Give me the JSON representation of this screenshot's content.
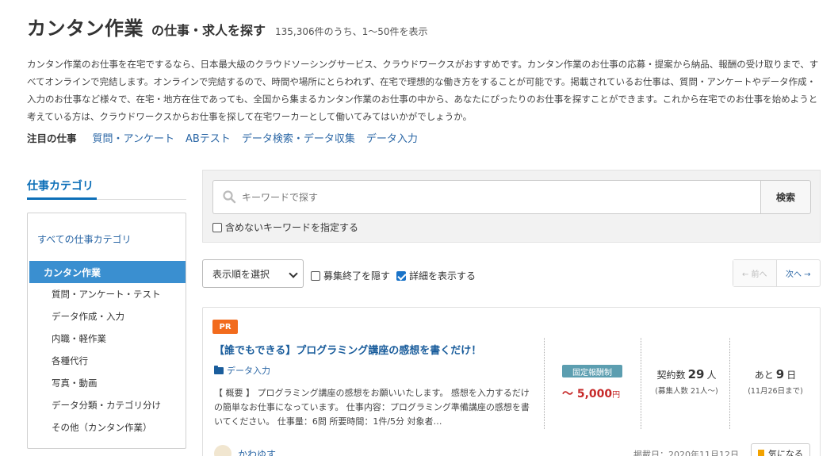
{
  "header": {
    "title": "カンタン作業",
    "subtitle": "の仕事・求人を探す",
    "count": "135,306件のうち、1～50件を表示"
  },
  "description": "カンタン作業のお仕事を在宅でするなら、日本最大級のクラウドソーシングサービス、クラウドワークスがおすすめです。カンタン作業のお仕事の応募・提案から納品、報酬の受け取りまで、すべてオンラインで完結します。オンラインで完結するので、時間や場所にとらわれず、在宅で理想的な働き方をすることが可能です。掲載されているお仕事は、質問・アンケートやデータ作成・入力のお仕事など様々で、在宅・地方在住であっても、全国から集まるカンタン作業のお仕事の中から、あなたにぴったりのお仕事を探すことができます。これから在宅でのお仕事を始めようと考えている方は、クラウドワークスからお仕事を探して在宅ワーカーとして働いてみてはいかがでしょうか。",
  "featured": {
    "label": "注目の仕事",
    "links": [
      "質問・アンケート",
      "ABテスト",
      "データ検索・データ収集",
      "データ入力"
    ]
  },
  "sidebar": {
    "title": "仕事カテゴリ",
    "all_label": "すべての仕事カテゴリ",
    "active_label": "カンタン作業",
    "items": [
      "質問・アンケート・テスト",
      "データ作成・入力",
      "内職・軽作業",
      "各種代行",
      "写真・動画",
      "データ分類・カテゴリ分け",
      "その他（カンタン作業）"
    ]
  },
  "search": {
    "placeholder": "キーワードで探す",
    "button_label": "検索",
    "exclude_label": "含めないキーワードを指定する"
  },
  "controls": {
    "sort_label": "表示順を選択",
    "hide_closed_label": "募集終了を隠す",
    "show_details_label": "詳細を表示する",
    "hide_closed_checked": false,
    "show_details_checked": true,
    "prev_label": "← 前へ",
    "next_label": "次へ →"
  },
  "job": {
    "badge": "PR",
    "title": "【誰でもできる】プログラミング講座の感想を書くだけ！",
    "category": "データ入力",
    "summary": "【 概要 】 プログラミング講座の感想をお願いいたします。 感想を入力するだけの簡単なお仕事になっています。 仕事内容：プログラミング準備講座の感想を書いてください。 仕事量：6問 所要時間：1件/5分 対象者…",
    "pay_type": "固定報酬制",
    "price_prefix": "～ ",
    "price": "5,000",
    "price_unit": "円",
    "contracts_label": "契約数",
    "contracts": "29",
    "contracts_unit": "人",
    "recruit_note": "(募集人数 21人～)",
    "days_prefix": "あと",
    "days": "9",
    "days_unit": "日",
    "deadline_note": "(11月26日まで)",
    "client": "かわゆす",
    "posted": "掲載日：2020年11月12日",
    "fav_label": "気になる"
  },
  "colors": {
    "accent": "#0d6fb8",
    "link": "#2a66a5",
    "price": "#c62828",
    "pr_badge": "#f26b1d",
    "pay_badge": "#5c9eb0",
    "sidebar_active": "#3a8fd0"
  }
}
